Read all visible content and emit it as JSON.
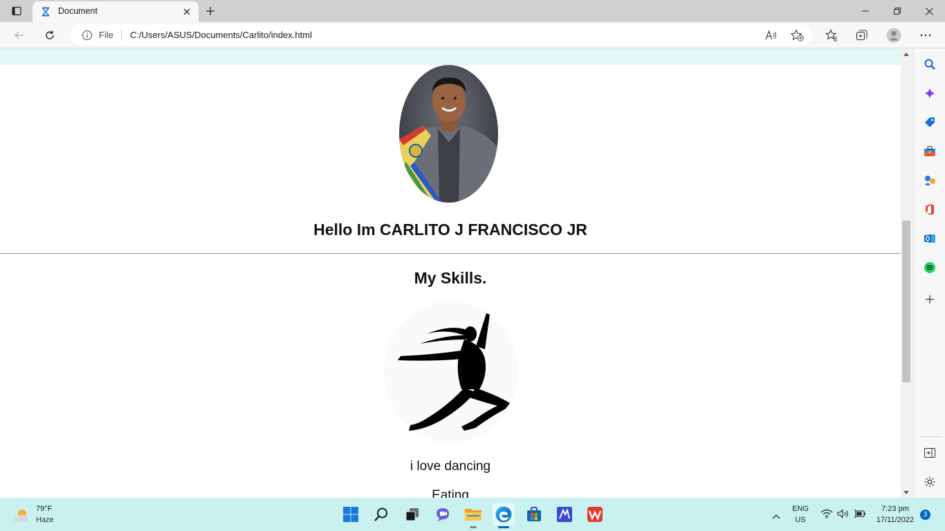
{
  "window": {
    "tab_title": "Document"
  },
  "address_bar": {
    "scheme_label": "File",
    "url": "C:/Users/ASUS/Documents/Carlito/index.html"
  },
  "page": {
    "greeting": "Hello Im CARLITO J FRANCISCO JR",
    "skills_heading": "My Skills.",
    "skills": [
      "i love dancing",
      "Eating"
    ],
    "top_band_color": "#e3f7f5"
  },
  "sidebar": {
    "icons": [
      "search-icon",
      "copilot-icon",
      "shopping-tag-icon",
      "tools-icon",
      "games-icon",
      "office-icon",
      "outlook-icon",
      "spotify-icon",
      "add-icon",
      "hide-sidebar-icon",
      "settings-icon"
    ]
  },
  "taskbar": {
    "weather_temp": "79°F",
    "weather_condition": "Haze",
    "language_primary": "ENG",
    "language_secondary": "US",
    "time": "7:23 pm",
    "date": "17/11/2022",
    "notification_count": "3",
    "apps": [
      "start-icon",
      "search-icon",
      "task-view-icon",
      "teams-chat-icon",
      "file-explorer-icon",
      "edge-icon",
      "store-icon",
      "app-icon",
      "wps-icon"
    ]
  }
}
